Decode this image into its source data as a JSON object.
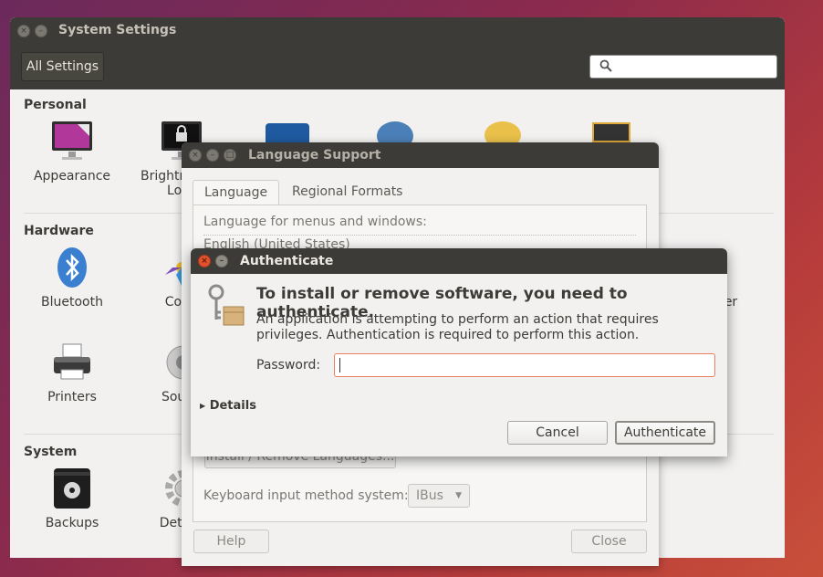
{
  "settings": {
    "title": "System Settings",
    "all_settings": "All Settings",
    "search_placeholder": "",
    "sections": {
      "personal": "Personal",
      "hardware": "Hardware",
      "system": "System"
    },
    "items": {
      "appearance": "Appearance",
      "brightness": "Brightness &",
      "brightness2": "Lock",
      "bluetooth": "Bluetooth",
      "color": "Color",
      "printers": "Printers",
      "sound": "Sound",
      "backups": "Backups",
      "details": "Details",
      "power_partial": "er"
    }
  },
  "language_support": {
    "title": "Language Support",
    "tabs": [
      "Language",
      "Regional Formats"
    ],
    "menus_label": "Language for menus and windows:",
    "first_language": "English (United States)",
    "install_remove": "Install / Remove Languages...",
    "keyboard_label": "Keyboard input method system:",
    "keyboard_value": "IBus",
    "help": "Help",
    "close": "Close"
  },
  "auth": {
    "title": "Authenticate",
    "heading": "To install or remove software, you need to authenticate.",
    "message": "An application is attempting to perform an action that requires privileges. Authentication is required to perform this action.",
    "password_label": "Password:",
    "password_value": "",
    "details": "Details",
    "cancel": "Cancel",
    "authenticate": "Authenticate"
  },
  "colors": {
    "titlebar": "#3c3b37",
    "close_button": "#e3522d",
    "accent_focus": "#e97e5c"
  }
}
